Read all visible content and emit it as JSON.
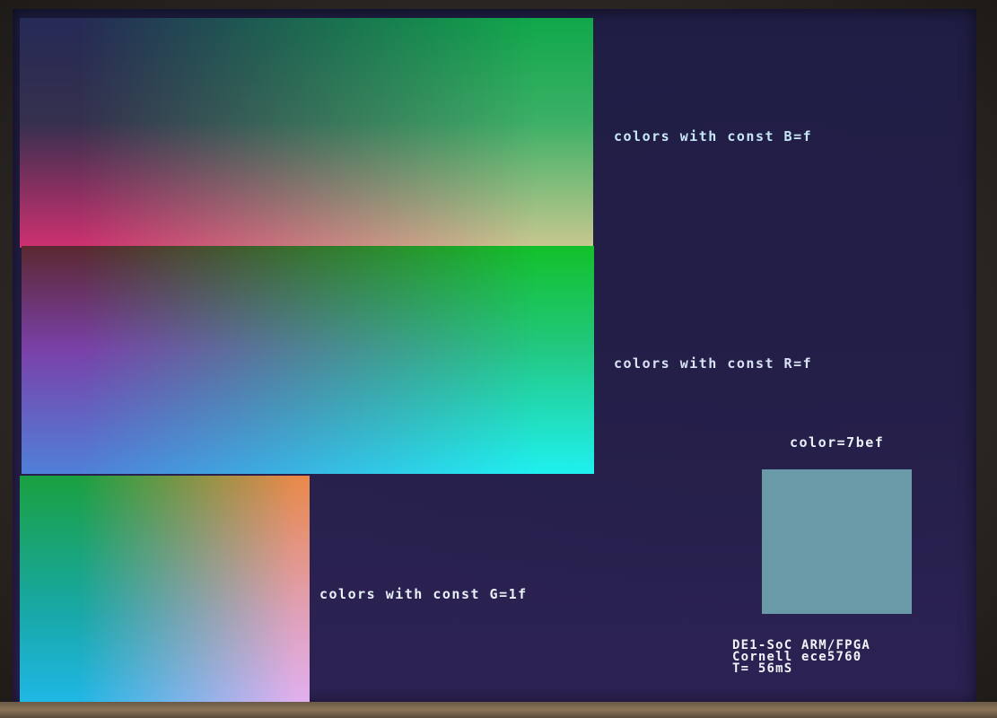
{
  "display": {
    "panels": {
      "const_b": {
        "label": "colors with const B=f"
      },
      "const_r": {
        "label": "colors with const R=f"
      },
      "const_g": {
        "label": "colors with const G=1f"
      }
    },
    "swatch": {
      "label": "color=7bef",
      "fill_color": "#6a9aa8"
    },
    "credits": {
      "line1": "DE1-SoC ARM/FPGA",
      "line2": "Cornell ece5760",
      "line3": "T= 56mS"
    }
  }
}
